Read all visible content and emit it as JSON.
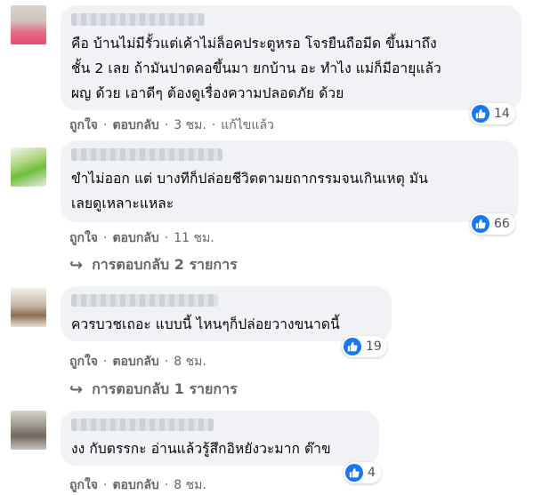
{
  "comments": [
    {
      "lines": [
        "คือ บ้านไม่มีรั้วแต่เค้าไม่ล็อคประตูหรอ โจรยืนถือมีด ขึ้นมาถึง",
        "ชั้น 2 เลย ถ้ามันปาดคอขึ้นมา ยกบ้าน อะ ทำไง แม่ก็มีอายุแล้ว",
        "ผญ ด้วย เอาดีๆ ต้องดูเรื่องความปลอดภัย ด้วย"
      ],
      "reactions": "14",
      "like": "ถูกใจ",
      "reply": "ตอบกลับ",
      "time": "3 ชม.",
      "edited": "แก้ไขแล้ว"
    },
    {
      "lines": [
        "ขำไม่ออก แต่ บางทีก็ปล่อยชีวิตตามยถากรรมจนเกินเหตุ มัน",
        "เลยดูเหลาะแหละ"
      ],
      "reactions": "66",
      "like": "ถูกใจ",
      "reply": "ตอบกลับ",
      "time": "11 ชม.",
      "replies": "การตอบกลับ 2 รายการ"
    },
    {
      "lines": [
        "ควรบวชเถอะ แบบนี้ ไหนๆก็ปล่อยวางขนาดนี้"
      ],
      "reactions": "19",
      "like": "ถูกใจ",
      "reply": "ตอบกลับ",
      "time": "8 ชม.",
      "replies": "การตอบกลับ 1 รายการ"
    },
    {
      "lines": [
        "งง กับตรรกะ อ่านแล้วรู้สึกอิหยังวะมาก ต๊าข"
      ],
      "reactions": "4",
      "like": "ถูกใจ",
      "reply": "ตอบกลับ",
      "time": "8 ชม."
    }
  ],
  "separator": "·",
  "colors": {
    "like_blue": "#1877f2",
    "bubble": "#f0f2f5",
    "meta_gray": "#65676b"
  },
  "icons": {
    "reaction": "like-icon",
    "reply_arrow": "reply-arrow-icon"
  }
}
